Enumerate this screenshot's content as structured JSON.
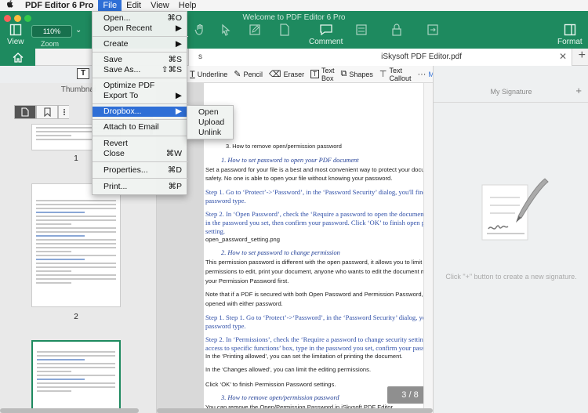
{
  "menubar": {
    "apple": "",
    "app": "PDF Editor 6 Pro",
    "items": [
      "File",
      "Edit",
      "View",
      "Help"
    ]
  },
  "toolbar": {
    "window_title": "Welcome to PDF Editor 6 Pro",
    "view_label": "View",
    "zoom_value": "110%",
    "zoom_label": "Zoom",
    "comment_label": "Comment",
    "format_label": "Format"
  },
  "tabs": {
    "doc_tab_title": "iSkysoft PDF Editor.pdf",
    "doc_tab_partial": "s"
  },
  "edit_toolbar": {
    "underline": "Underline",
    "pencil": "Pencil",
    "eraser": "Eraser",
    "text_box": "Text Box",
    "shapes": "Shapes",
    "text_callout": "Text Callout",
    "more": "More"
  },
  "thumbnails": {
    "title": "Thumbnai",
    "pages": [
      "1",
      "2"
    ]
  },
  "document": {
    "lines": {
      "l1": "3.    How to remove open/permission password",
      "l2": "1.         How to set password to open your PDF document",
      "l3": "Set a password for your file is a best and most convenient way to protect your documer",
      "l4": "safety. No one is able to open your file without knowing your password.",
      "l5": "Step 1. Go to ‘Protect’->‘Password’, in the ‘Password Security’ dialog, you'll find two",
      "l6": "password type.",
      "l7": "Step 2. In ‘Open Password’, check the ‘Require a password to open the document’ bo",
      "l8": "in the password you set, then confirm your password. Click ‘OK’ to finish open pass",
      "l9": "setting.",
      "l10": "open_password_setting.png",
      "l11": "2.         How to set password to change permission",
      "l12": "This permission password is different with the open password, it allows you to limit the",
      "l13": "permissions to edit, print your document, anyone who wants to edit the document mus",
      "l14": "your Permission Password first.",
      "l15": "Note that if a PDF is secured with both Open Password and Permission Password, it can",
      "l16": "opened with either password.",
      "l17": "Step 1. Step 1. Go to ‘Protect’->‘Password’, in the ‘Password Security’ dialog, you'll fi",
      "l18": "password type.",
      "l19": "Step 2. In ‘Permissions’, check the ‘Require a password to change security settings a",
      "l20": "access to specific functions’ box, type in the password you set, confirm your passwo",
      "l21": "In the ‘Printing allowed’, you can set the limitation of printing the document.",
      "l22": "In the ‘Changes allowed’, you can limit the editing permissions.",
      "l23": "Click ‘OK’ to finish Permission Password settings.",
      "l24": "3.         How to remove open/permission password",
      "l25": "You can remove the Open/Permission Password in iSkysoft PDF Editor."
    },
    "page_indicator": "3 / 8"
  },
  "signature": {
    "title": "My Signature",
    "hint": "Click \"+\" button to create a new signature."
  },
  "file_menu": {
    "open": "Open...",
    "open_sc": "⌘O",
    "open_recent": "Open Recent",
    "create": "Create",
    "save": "Save",
    "save_sc": "⌘S",
    "save_as": "Save As...",
    "save_as_sc": "⇧⌘S",
    "optimize": "Optimize PDF",
    "export": "Export To",
    "dropbox": "Dropbox...",
    "attach": "Attach to Email",
    "revert": "Revert",
    "close": "Close",
    "close_sc": "⌘W",
    "properties": "Properties...",
    "properties_sc": "⌘D",
    "print": "Print...",
    "print_sc": "⌘P"
  },
  "dropbox_submenu": [
    "Open",
    "Upload",
    "Unlink"
  ],
  "colors": {
    "brand_green": "#1e8a5f",
    "highlight": "#2f6fd6"
  }
}
